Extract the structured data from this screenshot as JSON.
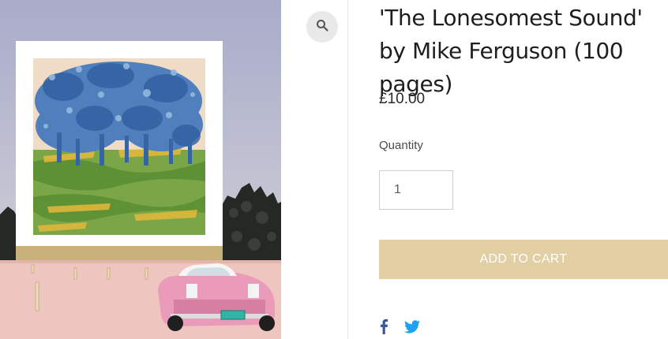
{
  "product": {
    "title": "'The Lonesomest Sound' by Mike Ferguson (100 pages)",
    "price": "£10.00",
    "quantity_label": "Quantity",
    "quantity_value": "1",
    "add_to_cart_label": "ADD TO CART"
  },
  "image": {
    "license_plate": "PORNSTER"
  },
  "icons": {
    "zoom": "magnifier-icon",
    "facebook": "facebook-icon",
    "twitter": "twitter-icon"
  },
  "colors": {
    "button_bg": "#e2cfa4",
    "button_text": "#ffffff",
    "facebook": "#3b5998",
    "twitter": "#1da1f2"
  }
}
